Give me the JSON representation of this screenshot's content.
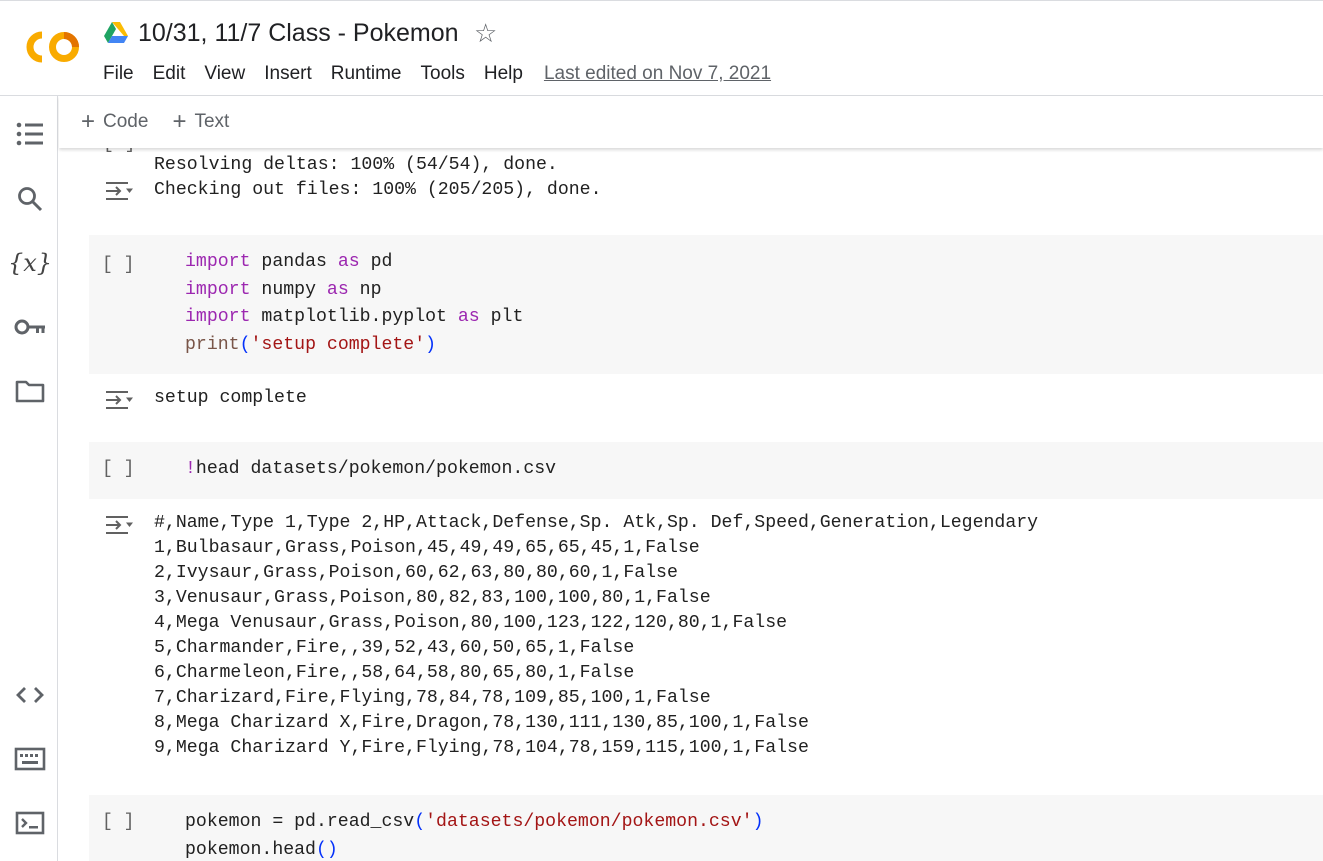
{
  "header": {
    "title": "10/31, 11/7 Class - Pokemon",
    "star_icon": "star-outline-icon",
    "last_edited": "Last edited on Nov 7, 2021",
    "menu": [
      "File",
      "Edit",
      "View",
      "Insert",
      "Runtime",
      "Tools",
      "Help"
    ],
    "logo_colors": {
      "orange": "#F9AB00",
      "dark_orange": "#E37400"
    }
  },
  "sidebar": {
    "icons": [
      "table-of-contents-icon",
      "search-icon",
      "variables-icon",
      "secrets-key-icon",
      "files-folder-icon",
      "code-snippets-icon",
      "command-palette-icon",
      "terminal-icon"
    ],
    "variables_label": "{x}"
  },
  "toolbar": {
    "add_code": "Code",
    "add_text": "Text"
  },
  "cells": {
    "prev_output": [
      "Resolving deltas: 100% (54/54), done.",
      "Checking out files: 100% (205/205), done."
    ],
    "run_bracket": "[ ]",
    "setup_output": "setup complete",
    "head_command": "!head datasets/pokemon/pokemon.csv",
    "csv_output": [
      "#,Name,Type 1,Type 2,HP,Attack,Defense,Sp. Atk,Sp. Def,Speed,Generation,Legendary",
      "1,Bulbasaur,Grass,Poison,45,49,49,65,65,45,1,False",
      "2,Ivysaur,Grass,Poison,60,62,63,80,80,60,1,False",
      "3,Venusaur,Grass,Poison,80,82,83,100,100,80,1,False",
      "4,Mega Venusaur,Grass,Poison,80,100,123,122,120,80,1,False",
      "5,Charmander,Fire,,39,52,43,60,50,65,1,False",
      "6,Charmeleon,Fire,,58,64,58,80,65,80,1,False",
      "7,Charizard,Fire,Flying,78,84,78,109,85,100,1,False",
      "8,Mega Charizard X,Fire,Dragon,78,130,111,130,85,100,1,False",
      "9,Mega Charizard Y,Fire,Flying,78,104,78,159,115,100,1,False"
    ],
    "import_code": {
      "kw_import": "import",
      "kw_as": "as",
      "m1": " pandas ",
      "a1": " pd",
      "m2": " numpy ",
      "a2": " np",
      "m3": " matplotlib.pyplot ",
      "a3": " plt",
      "print_fn": "print",
      "open_paren": "(",
      "print_arg": "'setup complete'",
      "close_paren": ")"
    },
    "read_code": {
      "lhs": "pokemon = pd.read_csv",
      "open_paren": "(",
      "arg": "'datasets/pokemon/pokemon.csv'",
      "close_paren": ")",
      "line2_text": "pokemon.head",
      "line2_parens": "()"
    }
  }
}
